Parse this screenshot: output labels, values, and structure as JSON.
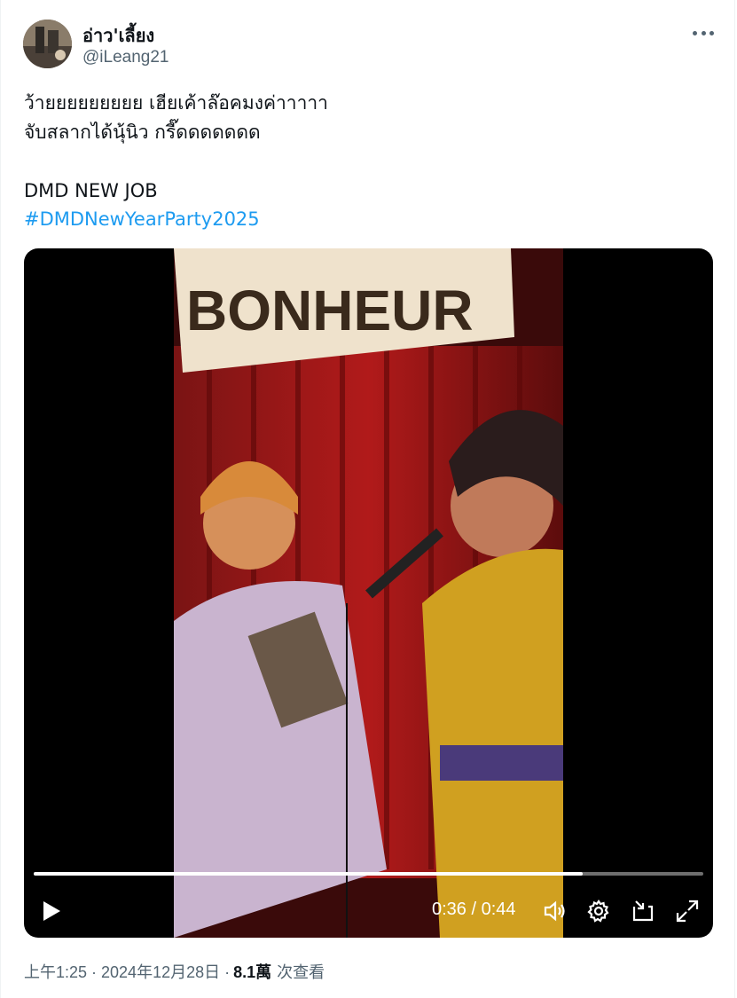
{
  "author": {
    "display_name": "อ่าว'เลี้ยง",
    "handle": "@iLeang21"
  },
  "post": {
    "text": "ว้ายยยยยยยยย เฮียเค้าล๊อคมงค่าาาาา\nจับสลากได้นุ้นิว กรี๊ดดดดดดด\n\nDMD NEW JOB",
    "hashtag": "#DMDNewYearParty2025"
  },
  "video": {
    "sign_text": "BONHEUR",
    "time_display": "0:36 / 0:44",
    "progress": 0.82
  },
  "meta": {
    "timestamp": "上午1:25 · 2024年12月28日 ·",
    "views": "8.1萬",
    "views_label": "次查看"
  },
  "icons": {
    "more": "more-horizontal-icon",
    "play": "play-icon",
    "volume": "volume-icon",
    "settings": "gear-icon",
    "pip": "picture-in-picture-icon",
    "fullscreen": "fullscreen-icon"
  },
  "colors": {
    "link": "#1d9bf0",
    "secondary_text": "#536471"
  }
}
